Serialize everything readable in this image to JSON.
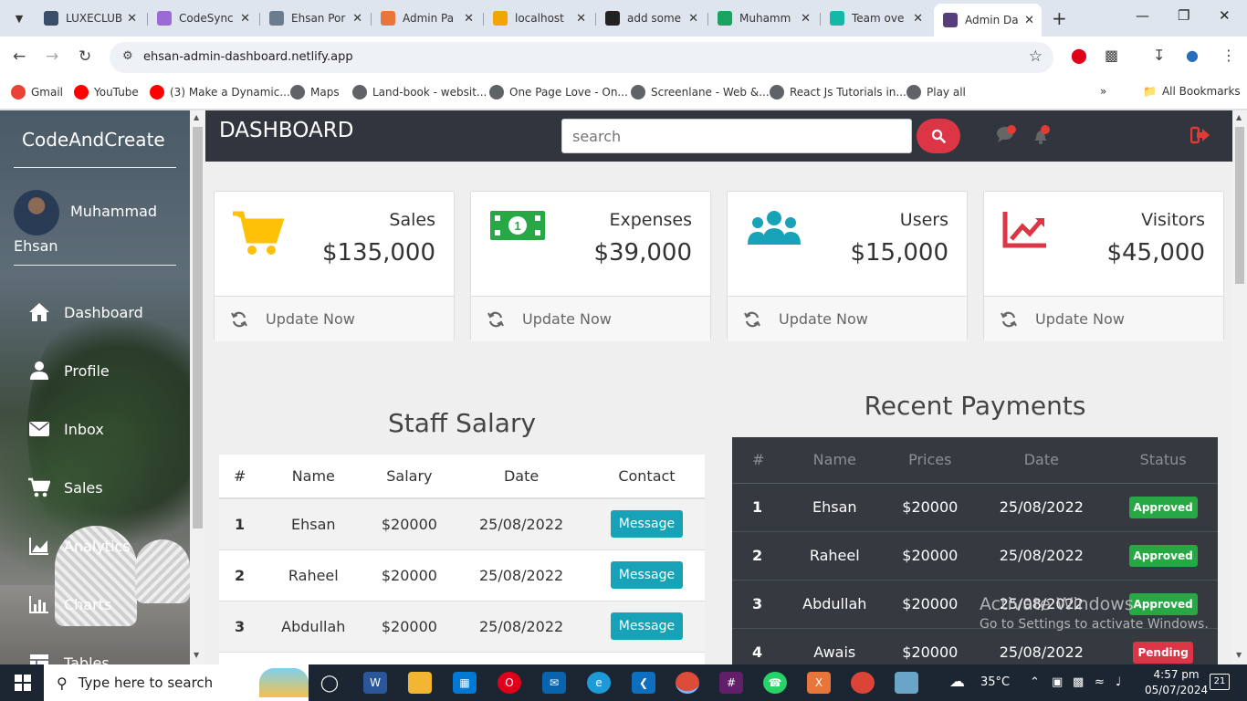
{
  "browser": {
    "tabs": [
      {
        "title": "LUXECLUB",
        "color": "#3a4d6b"
      },
      {
        "title": "CodeSync",
        "color": "#9b6ad4"
      },
      {
        "title": "Ehsan Por",
        "color": "#6b7c8c"
      },
      {
        "title": "Admin Pa",
        "color": "#e8753a"
      },
      {
        "title": "localhost",
        "color": "#f0a500"
      },
      {
        "title": "add some",
        "color": "#222222"
      },
      {
        "title": "Muhamm",
        "color": "#1aa260"
      },
      {
        "title": "Team ove",
        "color": "#14b8a6"
      },
      {
        "title": "Admin Da",
        "color": "#563d7c"
      }
    ],
    "active_tab_index": 8,
    "url": "ehsan-admin-dashboard.netlify.app",
    "bookmarks": [
      {
        "label": "Gmail",
        "color": "#ea4335"
      },
      {
        "label": "YouTube",
        "color": "#ff0000"
      },
      {
        "label": "(3) Make a Dynamic...",
        "color": "#ff0000"
      },
      {
        "label": "Maps",
        "color": "#5f6368"
      },
      {
        "label": "Land-book - websit...",
        "color": "#5f6368"
      },
      {
        "label": "One Page Love - On...",
        "color": "#5f6368"
      },
      {
        "label": "Screenlane - Web &...",
        "color": "#5f6368"
      },
      {
        "label": "React Js Tutorials in...",
        "color": "#5f6368"
      },
      {
        "label": "Play all",
        "color": "#5f6368"
      }
    ],
    "all_bookmarks": "All Bookmarks"
  },
  "sidebar": {
    "brand": "CodeAndCreate",
    "user_first": "Muhammad",
    "user_last": "Ehsan",
    "items": [
      {
        "label": "Dashboard",
        "icon": "home-icon"
      },
      {
        "label": "Profile",
        "icon": "user-icon"
      },
      {
        "label": "Inbox",
        "icon": "envelope-icon"
      },
      {
        "label": "Sales",
        "icon": "cart-icon"
      },
      {
        "label": "Analytics",
        "icon": "area-chart-icon"
      },
      {
        "label": "Charts",
        "icon": "bar-chart-icon"
      },
      {
        "label": "Tables",
        "icon": "table-icon"
      }
    ]
  },
  "topnav": {
    "title": "DASHBOARD",
    "search_placeholder": "search"
  },
  "cards": [
    {
      "label": "Sales",
      "value": "$135,000",
      "icon": "cart-icon",
      "color": "#ffc107",
      "footer": "Update Now"
    },
    {
      "label": "Expenses",
      "value": "$39,000",
      "icon": "money-icon",
      "color": "#28a745",
      "footer": "Update Now"
    },
    {
      "label": "Users",
      "value": "$15,000",
      "icon": "users-icon",
      "color": "#17a2b8",
      "footer": "Update Now"
    },
    {
      "label": "Visitors",
      "value": "$45,000",
      "icon": "trend-icon",
      "color": "#dc3545",
      "footer": "Update Now"
    }
  ],
  "staff_salary": {
    "title": "Staff Salary",
    "headers": [
      "#",
      "Name",
      "Salary",
      "Date",
      "Contact"
    ],
    "rows": [
      {
        "num": "1",
        "name": "Ehsan",
        "salary": "$20000",
        "date": "25/08/2022",
        "action": "Message"
      },
      {
        "num": "2",
        "name": "Raheel",
        "salary": "$20000",
        "date": "25/08/2022",
        "action": "Message"
      },
      {
        "num": "3",
        "name": "Abdullah",
        "salary": "$20000",
        "date": "25/08/2022",
        "action": "Message"
      }
    ]
  },
  "recent_payments": {
    "title": "Recent Payments",
    "headers": [
      "#",
      "Name",
      "Prices",
      "Date",
      "Status"
    ],
    "rows": [
      {
        "num": "1",
        "name": "Ehsan",
        "price": "$20000",
        "date": "25/08/2022",
        "status": "Approved",
        "status_color": "#28a745"
      },
      {
        "num": "2",
        "name": "Raheel",
        "price": "$20000",
        "date": "25/08/2022",
        "status": "Approved",
        "status_color": "#28a745"
      },
      {
        "num": "3",
        "name": "Abdullah",
        "price": "$20000",
        "date": "25/08/2022",
        "status": "Approved",
        "status_color": "#28a745"
      },
      {
        "num": "4",
        "name": "Awais",
        "price": "$20000",
        "date": "25/08/2022",
        "status": "Pending",
        "status_color": "#dc3545"
      }
    ]
  },
  "watermark": {
    "line1": "Activate Windows",
    "line2": "Go to Settings to activate Windows."
  },
  "taskbar": {
    "search_placeholder": "Type here to search",
    "temperature": "35°C",
    "time": "4:57 pm",
    "date": "05/07/2024",
    "notifications": "21"
  }
}
